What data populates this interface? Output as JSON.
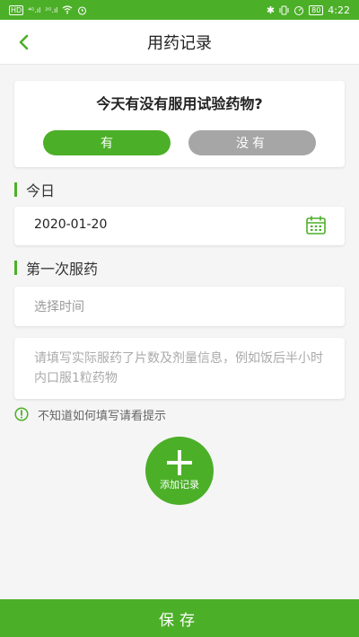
{
  "status_bar": {
    "sim_chip": "HD",
    "signal_1": "⁴ᴳ.ıl",
    "signal_2": "²ᴳ.ıl",
    "battery": "80",
    "time": "4:22"
  },
  "header": {
    "title": "用药记录"
  },
  "question": {
    "text": "今天有没有服用试验药物?",
    "yes_label": "有",
    "no_label": "没有"
  },
  "today": {
    "section_title": "今日",
    "date_value": "2020-01-20"
  },
  "first_dose": {
    "section_title": "第一次服药",
    "time_placeholder": "选择时间",
    "note_placeholder": "请填写实际服药了片数及剂量信息，例如饭后半小时内口服1粒药物"
  },
  "hint": {
    "text": "不知道如何填写请看提示"
  },
  "add_record": {
    "label": "添加记录"
  },
  "footer": {
    "save_label": "保存"
  },
  "colors": {
    "accent": "#4caf28",
    "disabled": "#a6a6a6"
  }
}
